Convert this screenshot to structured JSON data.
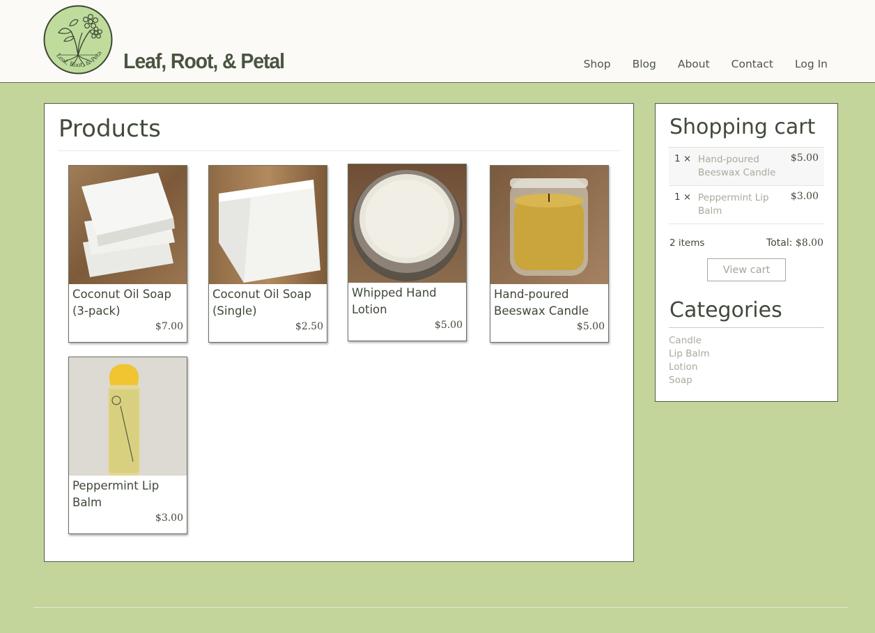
{
  "site": {
    "title": "Leaf, Root, & Petal",
    "logo_text": "Leaf, Root, & Petal"
  },
  "nav": {
    "items": [
      {
        "label": "Shop"
      },
      {
        "label": "Blog"
      },
      {
        "label": "About"
      },
      {
        "label": "Contact"
      },
      {
        "label": "Log In"
      }
    ]
  },
  "products": {
    "title": "Products",
    "items": [
      {
        "name": "Coconut Oil Soap (3-pack)",
        "price": "$7.00",
        "image": "stacked-soap-bars"
      },
      {
        "name": "Coconut Oil Soap (Single)",
        "price": "$2.50",
        "image": "single-soap-bar"
      },
      {
        "name": "Whipped Hand Lotion",
        "price": "$5.00",
        "image": "lotion-tin"
      },
      {
        "name": "Hand-poured Beeswax Candle",
        "price": "$5.00",
        "image": "beeswax-candle-jar"
      },
      {
        "name": "Peppermint Lip Balm",
        "price": "$3.00",
        "image": "lip-balm-tube"
      }
    ]
  },
  "cart": {
    "title": "Shopping cart",
    "items": [
      {
        "qty": "1 ×",
        "name": "Hand-poured Beeswax Candle",
        "price": "$5.00"
      },
      {
        "qty": "1 ×",
        "name": "Peppermint Lip Balm",
        "price": "$3.00"
      }
    ],
    "count": "2 items",
    "total_label": "Total:",
    "total": "$8.00",
    "view_cart_label": "View cart"
  },
  "categories": {
    "title": "Categories",
    "items": [
      "Candle",
      "Lip Balm",
      "Lotion",
      "Soap"
    ]
  },
  "colors": {
    "page_background": "#c3d59b",
    "header_background": "#fbfaf7",
    "link_muted": "#a7ab9c",
    "text_dark": "#3f4a3a"
  }
}
